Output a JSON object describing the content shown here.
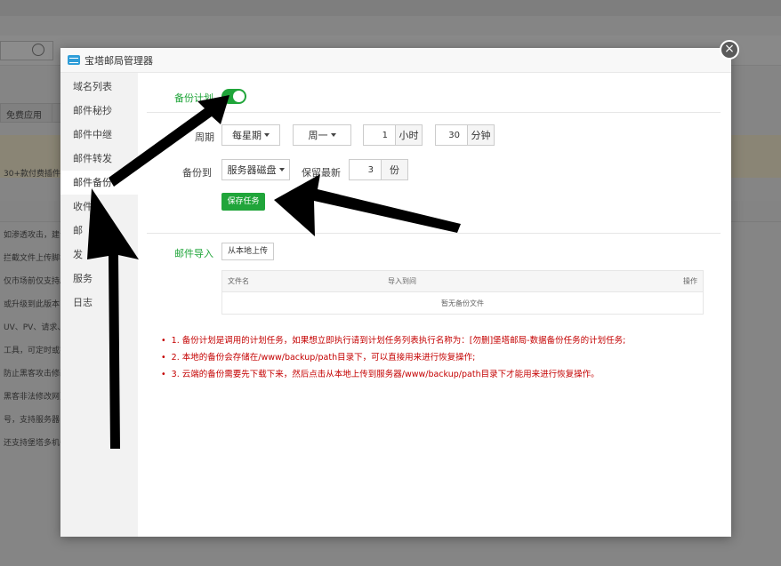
{
  "background": {
    "button_label": "免费应用",
    "notice_text": "30+款付费插件",
    "lines": [
      "如渗透攻击，建议",
      "拦截文件上传脚本",
      "仅市场前仅支持Ap",
      "或升级到此版本",
      "UV、PV、请求、量",
      "工具，可定时或实",
      "防止黑客攻击修改",
      "黑客非法修改网页",
      "号，支持服务器日",
      "还支持堡塔多机备"
    ]
  },
  "modal": {
    "title": "宝塔邮局管理器",
    "close_icon": "×"
  },
  "sidebar": {
    "items": [
      {
        "label": "域名列表"
      },
      {
        "label": "邮件秘抄"
      },
      {
        "label": "邮件中继"
      },
      {
        "label": "邮件转发"
      },
      {
        "label": "邮件备份"
      },
      {
        "label": "收件"
      },
      {
        "label": "邮"
      },
      {
        "label": "发"
      },
      {
        "label": "服务"
      },
      {
        "label": "日志"
      }
    ]
  },
  "backup_plan": {
    "label": "备份计划",
    "enabled": true,
    "cycle_label": "周期",
    "cycle_value": "每星期",
    "weekday_value": "周一",
    "hour_value": "1",
    "hour_unit": "小时",
    "minute_value": "30",
    "minute_unit": "分钟",
    "target_label": "备份到",
    "target_value": "服务器磁盘",
    "keep_label": "保留最新",
    "keep_value": "3",
    "keep_unit": "份",
    "save_button": "保存任务"
  },
  "mail_import": {
    "label": "邮件导入",
    "upload_button": "从本地上传",
    "table": {
      "columns": [
        "文件名",
        "导入到间",
        "操作"
      ],
      "empty_text": "暂无备份文件"
    }
  },
  "notes": [
    "1. 备份计划是调用的计划任务，如果想立即执行请到计划任务列表执行名称为：[勿删]堡塔邮局-数据备份任务的计划任务;",
    "2. 本地的备份会存储在/www/backup/path目录下，可以直接用来进行恢复操作;",
    "3. 云端的备份需要先下载下来，然后点击从本地上传到服务器/www/backup/path目录下才能用来进行恢复操作。"
  ],
  "colors": {
    "accent": "#20a53a",
    "note_text": "#c40000",
    "sidebar_bg": "#f2f2f2"
  }
}
